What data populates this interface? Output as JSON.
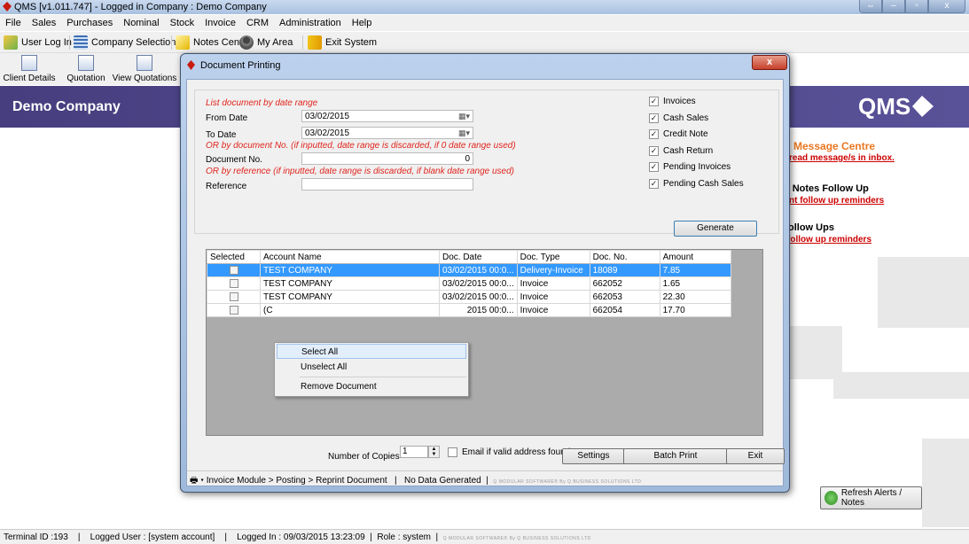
{
  "window": {
    "title": "QMS  [v1.011.747]  -  Logged in Company : Demo Company"
  },
  "menu": [
    "File",
    "Sales",
    "Purchases",
    "Nominal",
    "Stock",
    "Invoice",
    "CRM",
    "Administration",
    "Help"
  ],
  "toolbar1": {
    "user_login": "User Log In",
    "company_selection": "Company Selection",
    "notes_centre": "Notes Centre",
    "my_area": "My Area",
    "exit_system": "Exit System"
  },
  "toolbar2": {
    "client_details": "Client Details",
    "quotation": "Quotation",
    "view_quotations": "View Quotations"
  },
  "header": {
    "company": "Demo Company",
    "logo_text": "QMS"
  },
  "alerts": {
    "message_title": "Message Centre",
    "message_link": "read message/s in inbox.",
    "notes_title": "t Notes Follow Up",
    "notes_link": "nt follow up reminders",
    "followups_title": "ollow Ups",
    "followups_link": "follow up reminders",
    "refresh": "Refresh Alerts / Notes"
  },
  "statusbar": {
    "terminal": "Terminal ID :193",
    "user": "Logged User : [system account]",
    "login": "Logged In : 09/03/2015 13:23:09",
    "role": "Role : system",
    "brand": "Q MODULAR SOFTWARE® By Q BUSINESS SOLUTIONS LTD"
  },
  "dialog": {
    "title": "Document Printing",
    "close": "x",
    "date_range_hint": "List document by date range",
    "from_date_label": "From Date",
    "from_date_value": "03/02/2015",
    "to_date_label": "To Date",
    "to_date_value": "03/02/2015",
    "doc_no_hint": "OR  by document No. (if inputted, date range is discarded, if 0 date range used)",
    "doc_no_label": "Document No.",
    "doc_no_value": "0",
    "ref_hint": "OR  by reference (if inputted, date range is discarded, if blank date range used)",
    "reference_label": "Reference",
    "reference_value": "",
    "checkboxes": [
      {
        "label": "Invoices",
        "checked": true
      },
      {
        "label": "Cash Sales",
        "checked": true
      },
      {
        "label": "Credit Note",
        "checked": true
      },
      {
        "label": "Cash Return",
        "checked": true
      },
      {
        "label": "Pending Invoices",
        "checked": true
      },
      {
        "label": "Pending Cash Sales",
        "checked": true
      }
    ],
    "generate": "Generate",
    "grid": {
      "headers": [
        "Selected",
        "Account Name",
        "Doc. Date",
        "Doc. Type",
        "Doc. No.",
        "Amount"
      ],
      "rows": [
        {
          "account": "TEST COMPANY",
          "date": "03/02/2015 00:0...",
          "type": "Delivery-Invoice",
          "no": "18089",
          "amount": "7.85"
        },
        {
          "account": "TEST COMPANY",
          "date": "03/02/2015 00:0...",
          "type": "Invoice",
          "no": "662052",
          "amount": "1.65"
        },
        {
          "account": "TEST COMPANY",
          "date": "03/02/2015 00:0...",
          "type": "Invoice",
          "no": "662053",
          "amount": "22.30"
        },
        {
          "account": "(C",
          "date": "2015 00:0...",
          "type": "Invoice",
          "no": "662054",
          "amount": "17.70"
        }
      ]
    },
    "context_menu": [
      "Select All",
      "Unselect All",
      "Remove Document"
    ],
    "copies_label": "Number of Copies",
    "copies_value": "1",
    "email_label": "Email if valid address found",
    "settings": "Settings",
    "batch_print": "Batch Print",
    "exit": "Exit",
    "status_path": "Invoice Module > Posting > Reprint Document",
    "status_data": "No Data Generated",
    "status_brand": "Q MODULAR SOFTWARE® By Q BUSINESS SOLUTIONS LTD"
  },
  "colors": {
    "header_band": "#4d4589",
    "selected_row": "#3399ff",
    "hint_red": "#e0241c",
    "alert_orange": "#e87722"
  }
}
